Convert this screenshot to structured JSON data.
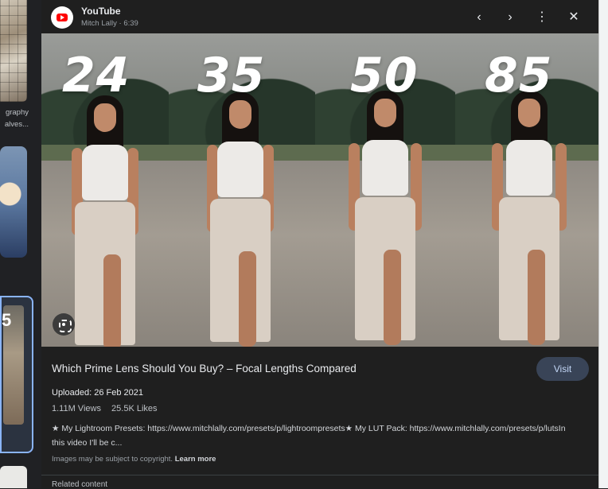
{
  "left_strip": {
    "text_line_1": "graphy",
    "text_line_2": "alves...",
    "selected_thumb_digit": "5"
  },
  "header": {
    "source_name": "YouTube",
    "source_meta": "Mitch Lally · 6:39",
    "prev_icon": "‹",
    "next_icon": "›",
    "more_icon": "⋮",
    "close_icon": "✕"
  },
  "image": {
    "labels": [
      "24",
      "35",
      "50",
      "85"
    ]
  },
  "details": {
    "title": "Which Prime Lens Should You Buy? – Focal Lengths Compared",
    "visit_label": "Visit",
    "uploaded": "Uploaded: 26 Feb 2021",
    "views": "1.11M Views",
    "likes": "25.5K Likes",
    "description": "★ My Lightroom Presets: https://www.mitchlally.com/presets/p/lightroompresets★ My LUT Pack: https://www.mitchlally.com/presets/p/lutsIn this video I'll be c...",
    "copyright_prefix": "Images may be subject to copyright.",
    "learn_more": "Learn more",
    "bottom_text": "Related content"
  },
  "colors": {
    "panel_bg": "#1f1f1f",
    "visit_bg": "#394457",
    "accent": "#8ab4f8"
  }
}
